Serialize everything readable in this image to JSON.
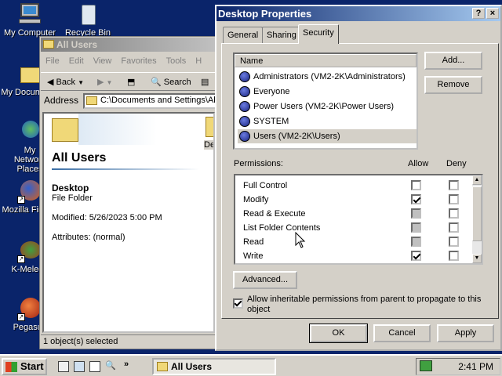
{
  "desktop": {
    "icons": [
      {
        "label": "My Computer"
      },
      {
        "label": "Recycle Bin"
      },
      {
        "label": "My Documents"
      },
      {
        "label": "My Network Places"
      },
      {
        "label": "Mozilla Firefox"
      },
      {
        "label": "K-Meleon"
      },
      {
        "label": "Pegasus"
      }
    ]
  },
  "explorer": {
    "title": "All Users",
    "menu": [
      "File",
      "Edit",
      "View",
      "Favorites",
      "Tools",
      "H"
    ],
    "toolbar": {
      "back": "Back",
      "search": "Search"
    },
    "address_label": "Address",
    "address_value": "C:\\Documents and Settings\\All Users",
    "folder_heading": "All Users",
    "selected_name": "Desktop",
    "selected_type": "File Folder",
    "modified": "Modified: 5/26/2023 5:00 PM",
    "attributes": "Attributes: (normal)",
    "right_item": "De",
    "status": "1 object(s) selected"
  },
  "dialog": {
    "title": "Desktop Properties",
    "title_buttons": {
      "help": "?",
      "close": "×"
    },
    "tabs": [
      "General",
      "Sharing",
      "Security"
    ],
    "active_tab": "Security",
    "name_header": "Name",
    "users": [
      "Administrators (VM2-2K\\Administrators)",
      "Everyone",
      "Power Users (VM2-2K\\Power Users)",
      "SYSTEM",
      "Users (VM2-2K\\Users)"
    ],
    "selected_user": "Users (VM2-2K\\Users)",
    "add_label": "Add...",
    "remove_label": "Remove",
    "permissions_label": "Permissions:",
    "allow_label": "Allow",
    "deny_label": "Deny",
    "permissions": [
      {
        "name": "Full Control",
        "allow": "unchecked",
        "deny": "unchecked"
      },
      {
        "name": "Modify",
        "allow": "checked",
        "deny": "unchecked"
      },
      {
        "name": "Read & Execute",
        "allow": "gray",
        "deny": "unchecked"
      },
      {
        "name": "List Folder Contents",
        "allow": "gray",
        "deny": "unchecked"
      },
      {
        "name": "Read",
        "allow": "gray",
        "deny": "unchecked"
      },
      {
        "name": "Write",
        "allow": "checked",
        "deny": "unchecked"
      }
    ],
    "advanced_label": "Advanced...",
    "inherit_text": "Allow inheritable permissions from parent to propagate to this object",
    "inherit_checked": true,
    "ok_label": "OK",
    "cancel_label": "Cancel",
    "apply_label": "Apply"
  },
  "taskbar": {
    "start_label": "Start",
    "task_label": "All Users",
    "clock": "2:41 PM"
  }
}
